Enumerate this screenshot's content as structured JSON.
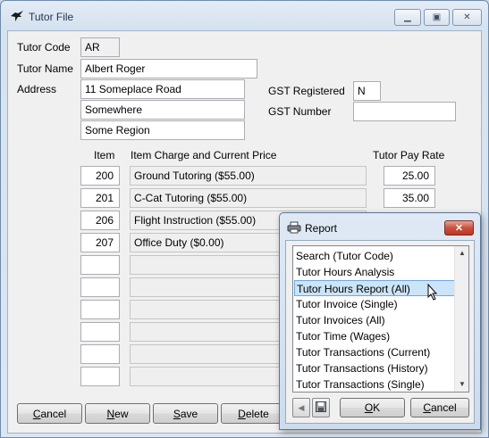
{
  "window": {
    "title": "Tutor File",
    "icon": "bird-icon"
  },
  "form": {
    "tutor_code_label": "Tutor Code",
    "tutor_code": "AR",
    "tutor_name_label": "Tutor Name",
    "tutor_name": "Albert Roger",
    "address_label": "Address",
    "address": [
      "11 Someplace Road",
      "Somewhere",
      "Some Region"
    ],
    "gst_registered_label": "GST Registered",
    "gst_registered": "N",
    "gst_number_label": "GST Number",
    "gst_number": ""
  },
  "items": {
    "col_item": "Item",
    "col_charge": "Item Charge and Current Price",
    "col_pay": "Tutor Pay Rate",
    "rows": [
      {
        "item": "200",
        "desc": "Ground Tutoring   ($55.00)",
        "pay": "25.00"
      },
      {
        "item": "201",
        "desc": "C-Cat Tutoring   ($55.00)",
        "pay": "35.00"
      },
      {
        "item": "206",
        "desc": "Flight Instruction   ($55.00)",
        "pay": ""
      },
      {
        "item": "207",
        "desc": "Office Duty   ($0.00)",
        "pay": ""
      },
      {
        "item": "",
        "desc": "",
        "pay": ""
      },
      {
        "item": "",
        "desc": "",
        "pay": ""
      },
      {
        "item": "",
        "desc": "",
        "pay": ""
      },
      {
        "item": "",
        "desc": "",
        "pay": ""
      },
      {
        "item": "",
        "desc": "",
        "pay": ""
      },
      {
        "item": "",
        "desc": "",
        "pay": ""
      }
    ]
  },
  "buttons": {
    "cancel": {
      "hot": "C",
      "rest": "ancel"
    },
    "new": {
      "hot": "N",
      "rest": "ew"
    },
    "save": {
      "hot": "S",
      "rest": "ave"
    },
    "delete": {
      "hot": "D",
      "rest": "elete"
    }
  },
  "report_dialog": {
    "title": "Report",
    "icon": "printer-icon",
    "items": [
      "Search (Tutor Code)",
      "Tutor Hours Analysis",
      "Tutor Hours Report (All)",
      "Tutor Invoice (Single)",
      "Tutor Invoices (All)",
      "Tutor Time (Wages)",
      "Tutor Transactions (Current)",
      "Tutor Transactions (History)",
      "Tutor Transactions (Single)"
    ],
    "selected_index": 2,
    "ok": {
      "hot": "O",
      "rest": "K"
    },
    "cancel": {
      "hot": "C",
      "rest": "ancel"
    }
  }
}
